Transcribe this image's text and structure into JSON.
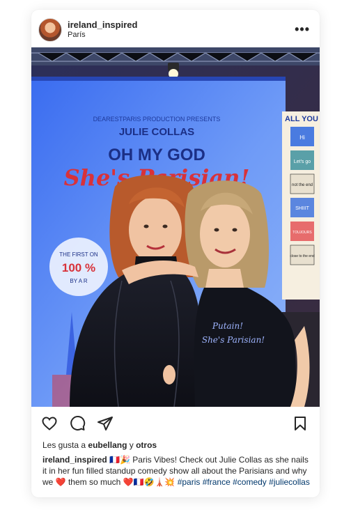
{
  "post": {
    "username": "ireland_inspired",
    "location": "París",
    "likes_prefix": "Les gusta a",
    "likes_user": "eubellang",
    "likes_joiner": "y",
    "likes_others": "otros",
    "caption_text": "🇫🇷🎉 Paris Vibes! Check out Julie Collas as she nails it in her fun filled standup comedy show all about the Parisians and why we ❤️ them so much ❤️🇫🇷🤣🗼💥",
    "hashtags": [
      "#paris",
      "#france",
      "#comedy",
      "#juliecollas"
    ]
  },
  "poster": {
    "production": "DEARESTPARIS PRODUCTION PRESENTS",
    "name": "JULIE COLLAS",
    "title_line1": "OH MY GOD",
    "title_line2": "She's Parisian!",
    "badge_line1": "THE FIRST ON",
    "badge_line2": "100 %",
    "badge_line3": "BY A R"
  },
  "shirt": {
    "line1": "Putain!",
    "line2": "She's Parisian!"
  },
  "wall_sign": {
    "header": "ALL YOU",
    "cards": [
      "Hi",
      "Let's go",
      "not the end",
      "SHIIIT",
      "TOUJOURS",
      "close to the end"
    ]
  },
  "icons": {
    "more": "more-options-icon",
    "like": "heart-icon",
    "comment": "comment-icon",
    "share": "share-icon",
    "save": "bookmark-icon"
  },
  "colors": {
    "text": "#262626",
    "hashtag": "#00376b",
    "poster_blue": "#2a4fd8",
    "poster_red": "#d8323a"
  }
}
